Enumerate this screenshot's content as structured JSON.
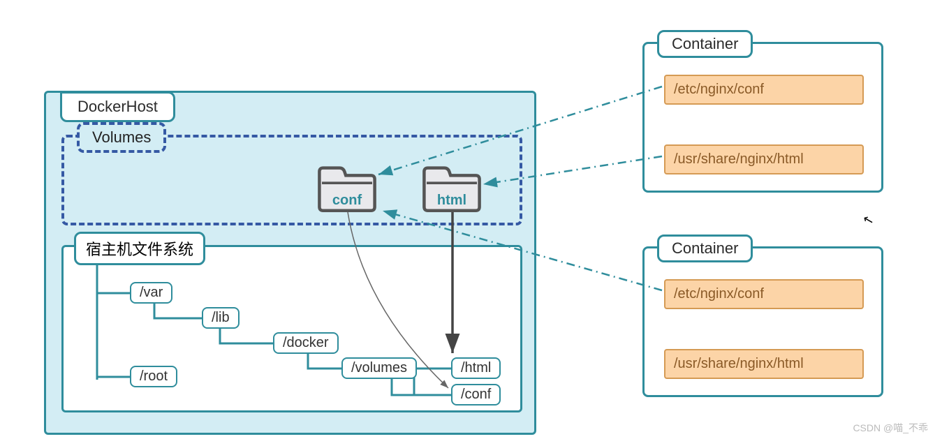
{
  "dockerhost": {
    "title": "DockerHost",
    "volumes": {
      "title": "Volumes",
      "folders": {
        "conf": "conf",
        "html": "html"
      }
    },
    "filesystem": {
      "title": "宿主机文件系统",
      "nodes": {
        "var": "/var",
        "lib": "/lib",
        "docker": "/docker",
        "volumes": "/volumes",
        "html": "/html",
        "conf": "/conf",
        "root": "/root"
      }
    }
  },
  "containers": [
    {
      "title": "Container",
      "paths": {
        "conf": "/etc/nginx/conf",
        "html": "/usr/share/nginx/html"
      }
    },
    {
      "title": "Container",
      "paths": {
        "conf": "/etc/nginx/conf",
        "html": "/usr/share/nginx/html"
      }
    }
  ],
  "watermark": "CSDN @喵_不乖"
}
